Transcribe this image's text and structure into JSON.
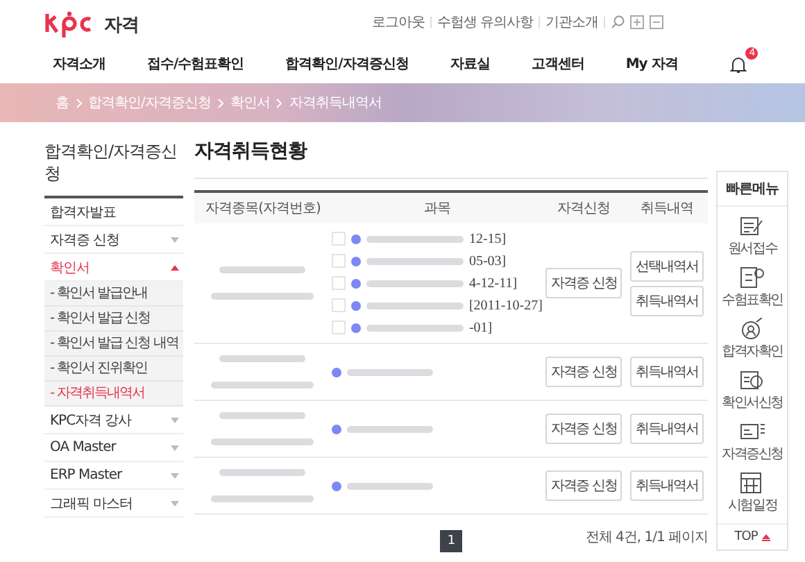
{
  "header": {
    "logo_text": "자격",
    "util_links": [
      "로그아웃",
      "수험생 유의사항",
      "기관소개"
    ],
    "nav": [
      "자격소개",
      "접수/수험표확인",
      "합격확인/자격증신청",
      "자료실",
      "고객센터",
      "My 자격"
    ],
    "notification_count": "4"
  },
  "breadcrumb": [
    "홈",
    "합격확인/자격증신청",
    "확인서",
    "자격취득내역서"
  ],
  "sidebar": {
    "title": "합격확인/자격증신청",
    "items": [
      {
        "label": "합격자발표",
        "selected": false
      },
      {
        "label": "자격증 신청",
        "selected": false,
        "expanded": false
      },
      {
        "label": "확인서",
        "selected": true,
        "expanded": true,
        "children": [
          {
            "label": "- 확인서 발급안내",
            "selected": false
          },
          {
            "label": "- 확인서 발급 신청",
            "selected": false
          },
          {
            "label": "- 확인서 발급 신청 내역",
            "selected": false
          },
          {
            "label": "- 확인서 진위확인",
            "selected": false
          },
          {
            "label": "- 자격취득내역서",
            "selected": true
          }
        ]
      },
      {
        "label": "KPC자격 강사",
        "selected": false,
        "expanded": false
      },
      {
        "label": "OA Master",
        "selected": false,
        "expanded": false
      },
      {
        "label": "ERP Master",
        "selected": false,
        "expanded": false
      },
      {
        "label": "그래픽 마스터",
        "selected": false,
        "expanded": false
      }
    ]
  },
  "page_title": "자격취득현황",
  "table": {
    "columns": [
      "자격종목(자격번호)",
      "과목",
      "자격신청",
      "취득내역"
    ],
    "rows": [
      {
        "subjects": [
          {
            "kind": "checkbox",
            "checked": false,
            "date": "12-15]"
          },
          {
            "kind": "checkbox",
            "checked": false,
            "date": "05-03]"
          },
          {
            "kind": "checkbox",
            "checked": false,
            "date": "4-12-11]"
          },
          {
            "kind": "checkbox",
            "checked": false,
            "date": "[2011-10-27]"
          },
          {
            "kind": "checkbox",
            "checked": false,
            "date": "-01]"
          }
        ],
        "apply_button": "자격증 신청",
        "history_buttons": [
          "선택내역서",
          "취득내역서"
        ]
      },
      {
        "subjects": [
          {
            "kind": "plain"
          }
        ],
        "apply_button": "자격증 신청",
        "history_buttons": [
          "취득내역서"
        ]
      },
      {
        "subjects": [
          {
            "kind": "plain"
          }
        ],
        "apply_button": "자격증 신청",
        "history_buttons": [
          "취득내역서"
        ]
      },
      {
        "subjects": [
          {
            "kind": "plain"
          }
        ],
        "apply_button": "자격증 신청",
        "history_buttons": [
          "취득내역서"
        ]
      }
    ]
  },
  "pagination": {
    "pages": [
      {
        "label": "1",
        "selected": true
      }
    ],
    "summary": "전체 4건, 1/1 페이지"
  },
  "quick_menu": {
    "title": "빠른메뉴",
    "items": [
      "원서접수",
      "수험표확인",
      "합격자확인",
      "확인서신청",
      "자격증신청",
      "시험일정"
    ],
    "top": "TOP"
  }
}
